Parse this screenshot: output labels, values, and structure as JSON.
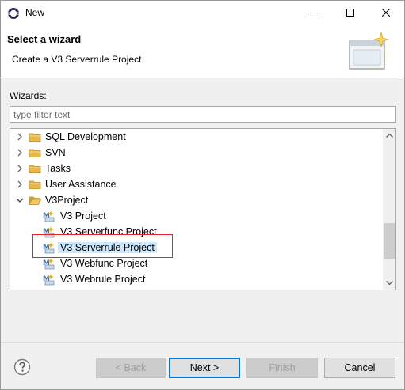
{
  "window": {
    "title": "New"
  },
  "banner": {
    "title": "Select a wizard",
    "description": "Create a V3 Serverrule Project"
  },
  "wizards_label": "Wizards:",
  "filter": {
    "placeholder": "type filter text",
    "value": ""
  },
  "tree": {
    "items": [
      {
        "label": "SQL Development",
        "type": "folder",
        "expanded": false
      },
      {
        "label": "SVN",
        "type": "folder",
        "expanded": false
      },
      {
        "label": "Tasks",
        "type": "folder",
        "expanded": false
      },
      {
        "label": "User Assistance",
        "type": "folder",
        "expanded": false
      },
      {
        "label": "V3Project",
        "type": "folder",
        "expanded": true
      },
      {
        "label": "V3 Project",
        "type": "wizard"
      },
      {
        "label": "V3 Serverfunc Project",
        "type": "wizard"
      },
      {
        "label": "V3 Serverrule Project",
        "type": "wizard",
        "selected": true
      },
      {
        "label": "V3 Webfunc Project",
        "type": "wizard"
      },
      {
        "label": "V3 Webrule Project",
        "type": "wizard"
      }
    ]
  },
  "buttons": {
    "back": "< Back",
    "next": "Next >",
    "finish": "Finish",
    "cancel": "Cancel"
  },
  "colors": {
    "selection": "#cce8ff",
    "highlight_box": "#e0262b",
    "default_button_border": "#0078d7",
    "folder": "#e8b84a"
  }
}
